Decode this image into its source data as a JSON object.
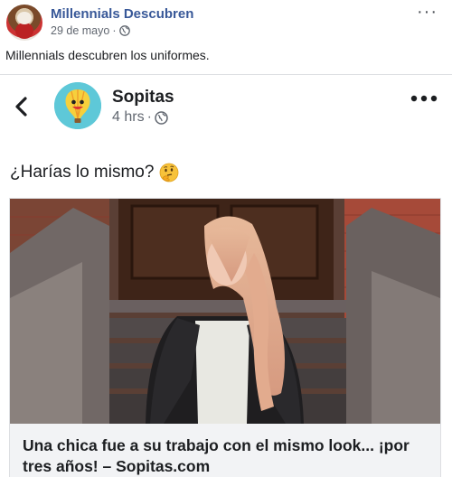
{
  "outer_post": {
    "page_name": "Millennials Descubren",
    "date": "29 de mayo",
    "separator": "·",
    "text": "Millennials descubren los uniformes.",
    "more_label": "···"
  },
  "shared_post": {
    "page_name": "Sopitas",
    "time": "4 hrs",
    "separator": "·",
    "question": "¿Harías lo mismo?",
    "question_emoji": "thinking-face-icon",
    "link_title": "Una chica fue a su trabajo con el mismo look... ¡por tres años! – Sopitas.com"
  },
  "colors": {
    "link_blue": "#385898",
    "meta_gray": "#616770",
    "caption_bg": "#f2f3f5"
  }
}
